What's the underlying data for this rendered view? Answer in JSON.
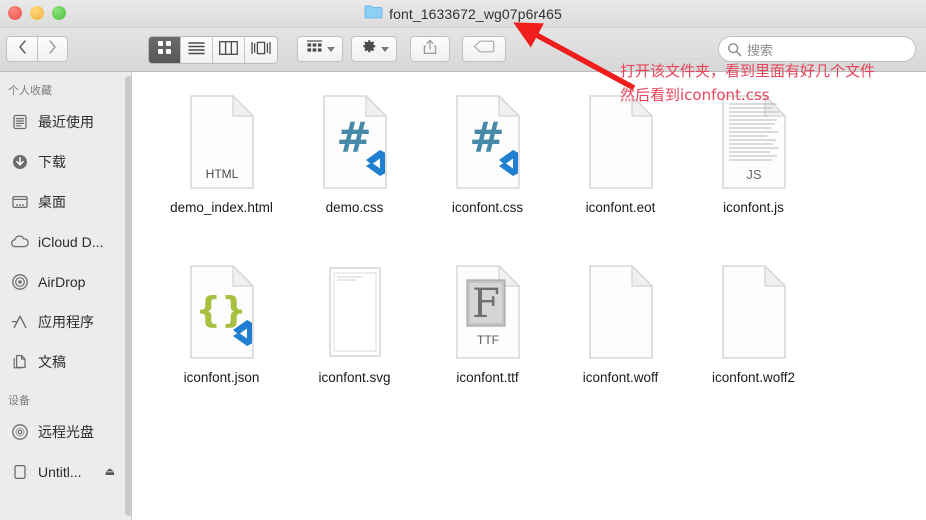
{
  "window": {
    "title": "font_1633672_wg07p6r465",
    "folder_icon": "folder-icon",
    "traffic_lights": [
      {
        "name": "close-button",
        "color": "#ef5f56"
      },
      {
        "name": "minimize-button",
        "color": "#f5bd4f"
      },
      {
        "name": "maximize-button",
        "color": "#5fc94d"
      }
    ]
  },
  "toolbar": {
    "back_icon": "chevron-left-icon",
    "forward_icon": "chevron-right-icon",
    "view_modes": [
      {
        "name": "icon-view",
        "icon": "grid-icon",
        "active": true
      },
      {
        "name": "list-view",
        "icon": "list-icon",
        "active": false
      },
      {
        "name": "column-view",
        "icon": "columns-icon",
        "active": false
      },
      {
        "name": "gallery-view",
        "icon": "coverflow-icon",
        "active": false
      }
    ],
    "arrange_icon": "arrange-grid-icon",
    "action_icon": "gear-icon",
    "share_icon": "share-icon",
    "tag_icon": "tag-icon"
  },
  "search": {
    "placeholder": "搜索",
    "icon": "search-icon",
    "value": ""
  },
  "sidebar": {
    "sections": [
      {
        "title": "个人收藏",
        "items": [
          {
            "label": "最近使用",
            "icon": "recents-icon",
            "eject": false
          },
          {
            "label": "下载",
            "icon": "downloads-icon",
            "eject": false
          },
          {
            "label": "桌面",
            "icon": "desktop-icon",
            "eject": false
          },
          {
            "label": "iCloud D...",
            "icon": "icloud-icon",
            "eject": false
          },
          {
            "label": "AirDrop",
            "icon": "airdrop-icon",
            "eject": false
          },
          {
            "label": "应用程序",
            "icon": "applications-icon",
            "eject": false
          },
          {
            "label": "文稿",
            "icon": "documents-icon",
            "eject": false
          }
        ]
      },
      {
        "title": "设备",
        "items": [
          {
            "label": "远程光盘",
            "icon": "disc-icon",
            "eject": false
          },
          {
            "label": "Untitl...",
            "icon": "drive-icon",
            "eject": true,
            "eject_glyph": "⏏"
          }
        ]
      }
    ]
  },
  "files": [
    {
      "name": "demo_index.html",
      "icon": "document-html-icon",
      "badge": "",
      "glyph": "",
      "sublabel": "HTML"
    },
    {
      "name": "demo.css",
      "icon": "document-css-icon",
      "badge": "vscode-badge",
      "glyph": "#",
      "sublabel": ""
    },
    {
      "name": "iconfont.css",
      "icon": "document-css-icon",
      "badge": "vscode-badge",
      "glyph": "#",
      "sublabel": ""
    },
    {
      "name": "iconfont.eot",
      "icon": "document-blank-icon",
      "badge": "",
      "glyph": "",
      "sublabel": ""
    },
    {
      "name": "iconfont.js",
      "icon": "document-js-icon",
      "badge": "",
      "glyph": "",
      "sublabel": "JS"
    },
    {
      "name": "iconfont.json",
      "icon": "document-json-icon",
      "badge": "vscode-badge",
      "glyph": "{}",
      "sublabel": ""
    },
    {
      "name": "iconfont.svg",
      "icon": "document-svg-icon",
      "badge": "",
      "glyph": "",
      "sublabel": ""
    },
    {
      "name": "iconfont.ttf",
      "icon": "document-ttf-icon",
      "badge": "",
      "glyph": "F",
      "sublabel": "TTF"
    },
    {
      "name": "iconfont.woff",
      "icon": "document-blank-icon",
      "badge": "",
      "glyph": "",
      "sublabel": ""
    },
    {
      "name": "iconfont.woff2",
      "icon": "document-blank-icon",
      "badge": "",
      "glyph": "",
      "sublabel": ""
    }
  ],
  "annotations": {
    "color": "#e8455c",
    "arrow_name": "red-arrow-annotation",
    "line1": "打开该文件夹，看到里面有好几个文件",
    "line2": "然后看到iconfont.css"
  }
}
